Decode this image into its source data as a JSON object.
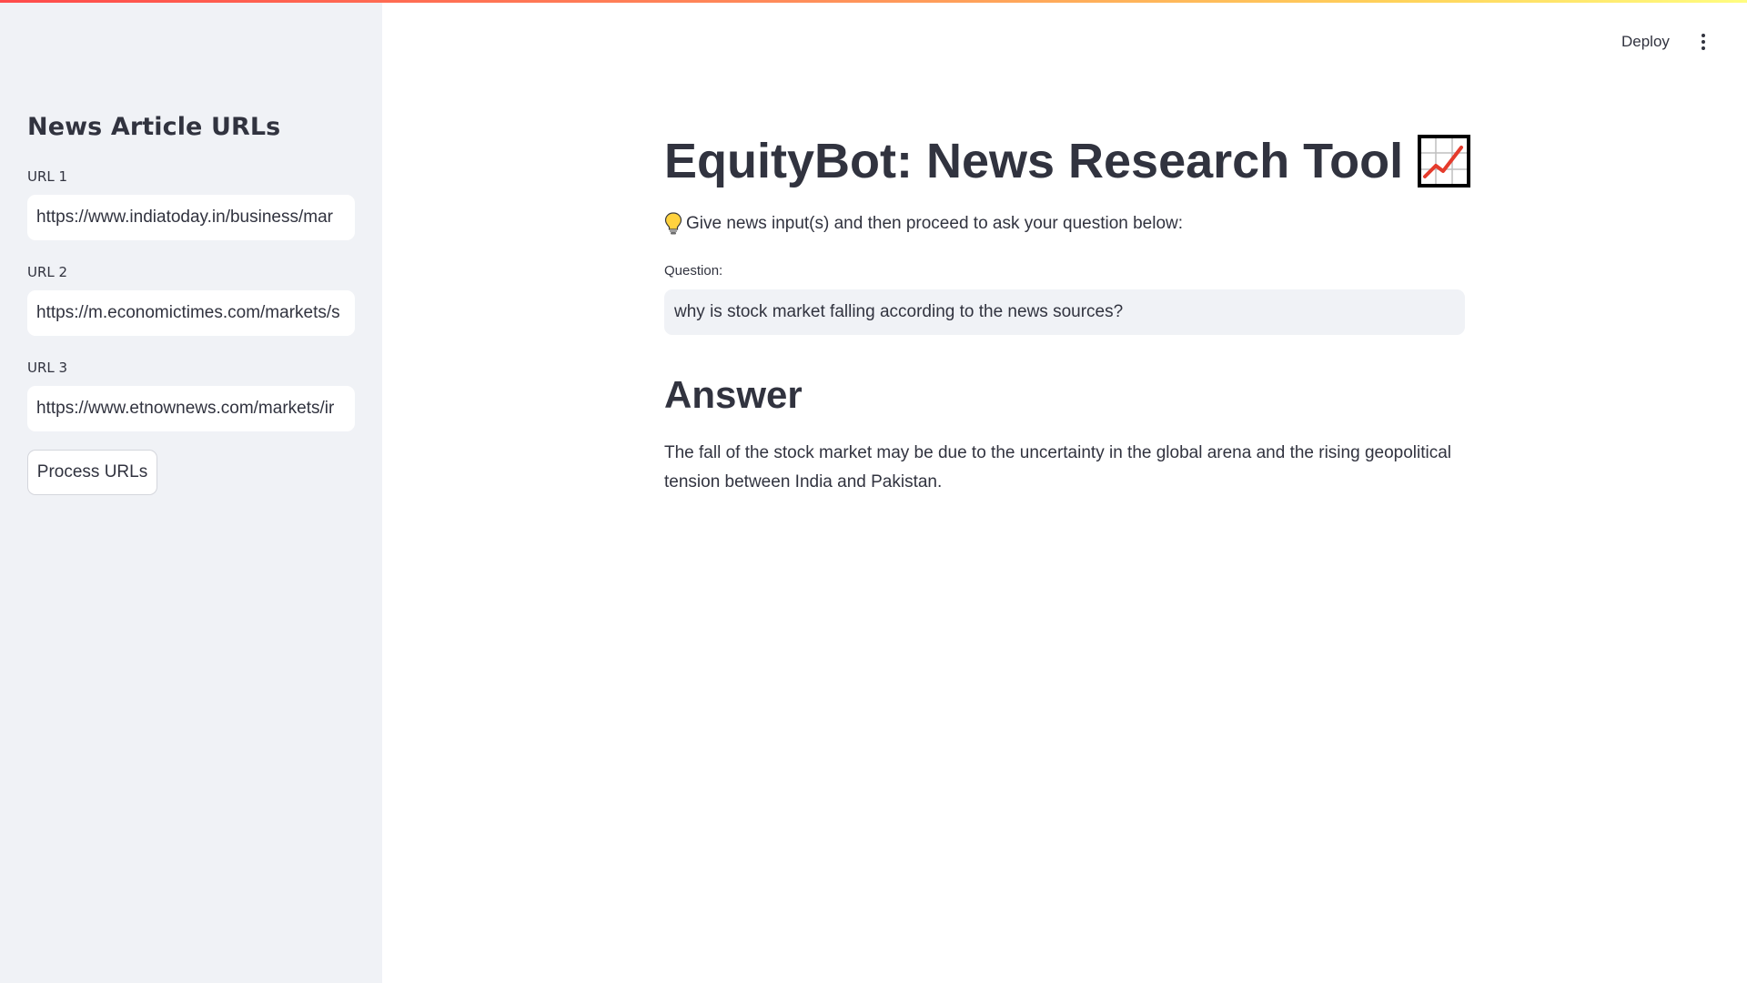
{
  "colors": {
    "sidebar_bg": "#f0f2f6",
    "text": "#31333f",
    "accent_red": "#ff4b4b",
    "accent_yellow": "#fffd80"
  },
  "header": {
    "deploy_label": "Deploy",
    "menu_icon": "vertical-dots-icon"
  },
  "sidebar": {
    "title": "News Article URLs",
    "urls": [
      {
        "label": "URL 1",
        "value": "https://www.indiatoday.in/business/mar"
      },
      {
        "label": "URL 2",
        "value": "https://m.economictimes.com/markets/s"
      },
      {
        "label": "URL 3",
        "value": "https://www.etnownews.com/markets/ir"
      }
    ],
    "process_button": "Process URLs"
  },
  "main": {
    "title": "EquityBot: News Research Tool",
    "title_icon": "chart-increasing-icon",
    "intro_icon": "light-bulb-icon",
    "intro": "Give news input(s) and then proceed to ask your question below:",
    "question_label": "Question:",
    "question_value": "why is stock market falling according to the news sources?",
    "answer_heading": "Answer",
    "answer_text": "The fall of the stock market may be due to the uncertainty in the global arena and the rising geopolitical tension between India and Pakistan."
  }
}
